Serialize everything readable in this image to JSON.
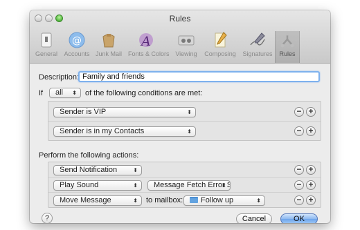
{
  "window": {
    "title": "Rules"
  },
  "toolbar": {
    "items": [
      {
        "label": "General",
        "icon": "switch-icon"
      },
      {
        "label": "Accounts",
        "icon": "at-sign-icon"
      },
      {
        "label": "Junk Mail",
        "icon": "trash-bag-icon"
      },
      {
        "label": "Fonts & Colors",
        "icon": "font-icon"
      },
      {
        "label": "Viewing",
        "icon": "viewing-glasses-icon"
      },
      {
        "label": "Composing",
        "icon": "pencil-icon"
      },
      {
        "label": "Signatures",
        "icon": "pen-icon"
      },
      {
        "label": "Rules",
        "icon": "rules-icon",
        "selected": true
      }
    ]
  },
  "rule": {
    "description_label": "Description:",
    "description_value": "Family and friends",
    "if_label": "If",
    "match_mode": "all",
    "conditions_suffix": "of the following conditions are met:",
    "conditions": [
      {
        "criterion": "Sender is VIP"
      },
      {
        "criterion": "Sender is in my Contacts"
      }
    ],
    "actions_label": "Perform the following actions:",
    "actions": [
      {
        "action": "Send Notification"
      },
      {
        "action": "Play Sound",
        "sound": "Message Fetch Error Sou"
      },
      {
        "action": "Move Message",
        "to_label": "to mailbox:",
        "mailbox": "Follow up"
      }
    ]
  },
  "buttons": {
    "minus": "−",
    "plus": "+",
    "help": "?",
    "cancel": "Cancel",
    "ok": "OK"
  },
  "colors": {
    "focus_ring": "#7eb1ed",
    "default_button": "#6ea5ec",
    "folder": "#63a3e0"
  }
}
